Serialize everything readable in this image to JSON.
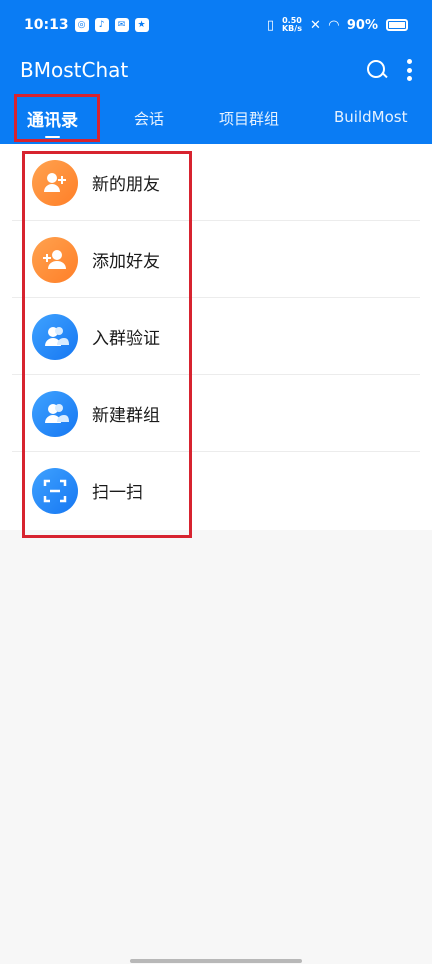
{
  "status": {
    "time": "10:13",
    "speed_top": "0.50",
    "speed_bottom": "KB/s",
    "battery": "90%"
  },
  "app": {
    "title": "BMostChat"
  },
  "tabs": [
    {
      "label": "通讯录",
      "active": true
    },
    {
      "label": "会话",
      "active": false
    },
    {
      "label": "项目群组",
      "active": false
    },
    {
      "label": "BuildMost",
      "active": false
    }
  ],
  "menu": {
    "items": [
      {
        "label": "新的朋友",
        "icon": "person-plus-icon",
        "color": "#ff8a2f"
      },
      {
        "label": "添加好友",
        "icon": "add-friend-icon",
        "color": "#ff8a2f"
      },
      {
        "label": "入群验证",
        "icon": "group-icon",
        "color": "#1d84f5"
      },
      {
        "label": "新建群组",
        "icon": "group-icon",
        "color": "#1d84f5"
      },
      {
        "label": "扫一扫",
        "icon": "scan-icon",
        "color": "#1d84f5"
      }
    ]
  },
  "colors": {
    "primary": "#0a7cf4",
    "highlight": "#d7232f"
  }
}
